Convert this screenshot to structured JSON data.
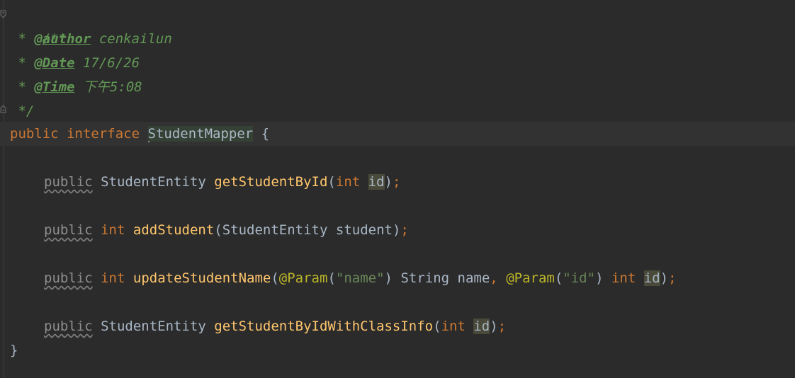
{
  "editor": {
    "doc_comment": {
      "open": "/**",
      "star": " * ",
      "author_tag": "@author",
      "author_value": " cenkailun",
      "date_tag": "@Date",
      "date_value": " 17/6/26",
      "time_tag": "@Time",
      "time_value": " 下午5:08",
      "close": " */"
    },
    "interface_line": {
      "public": "public",
      "interface": "interface",
      "name": "StudentMapper",
      "brace": "{"
    },
    "methods": [
      {
        "modifier": "public",
        "return_type": "StudentEntity",
        "name": "getStudentById",
        "params_text": "int",
        "param_name": "id"
      },
      {
        "modifier": "public",
        "return_type": "int",
        "name": "addStudent",
        "param_type": "StudentEntity",
        "param_name": "student"
      },
      {
        "modifier": "public",
        "return_type": "int",
        "name": "updateStudentName",
        "ann1": "@Param",
        "str1": "\"name\"",
        "type1": "String",
        "var1": "name",
        "ann2": "@Param",
        "str2": "\"id\"",
        "type2": "int",
        "var2": "id"
      },
      {
        "modifier": "public",
        "return_type": "StudentEntity",
        "name": "getStudentByIdWithClassInfo",
        "param_type": "int",
        "param_name": "id"
      }
    ],
    "closing_brace": "}"
  },
  "colors": {
    "background": "#2b2b2b",
    "keyword": "#cc7832",
    "method": "#ffc66d",
    "doc": "#629755",
    "string": "#6a8759",
    "annotation": "#bbb529",
    "text": "#a9b7c6"
  }
}
